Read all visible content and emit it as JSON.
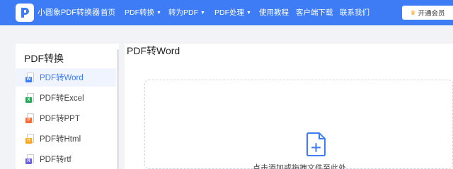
{
  "header": {
    "brand": "小圆象PDF转换器",
    "nav": [
      {
        "label": "首页",
        "dropdown": false
      },
      {
        "label": "PDF转换",
        "dropdown": true
      },
      {
        "label": "转为PDF",
        "dropdown": true
      },
      {
        "label": "PDF处理",
        "dropdown": true
      },
      {
        "label": "使用教程",
        "dropdown": false
      },
      {
        "label": "客户端下载",
        "dropdown": false
      },
      {
        "label": "联系我们",
        "dropdown": false
      }
    ],
    "vip_label": "开通会员"
  },
  "sidebar": {
    "title": "PDF转换",
    "items": [
      {
        "label": "PDF转Word",
        "icon": "word-file-icon",
        "tag": "W",
        "color": "#3d7cf4",
        "active": true
      },
      {
        "label": "PDF转Excel",
        "icon": "excel-file-icon",
        "tag": "X",
        "color": "#2ea35a",
        "active": false
      },
      {
        "label": "PDF转PPT",
        "icon": "ppt-file-icon",
        "tag": "P",
        "color": "#f26b3a",
        "active": false
      },
      {
        "label": "PDF转Html",
        "icon": "html-file-icon",
        "tag": "H",
        "color": "#f5a623",
        "active": false
      },
      {
        "label": "PDF转rtf",
        "icon": "rtf-file-icon",
        "tag": "R",
        "color": "#6c63d9",
        "active": false
      }
    ]
  },
  "main": {
    "title": "PDF转Word",
    "drop_text": "点击添加或拖拽文件至此处"
  },
  "colors": {
    "header_bg": "#3d7cf4",
    "accent": "#3d7cf4",
    "page_bg": "#f2f3f7"
  }
}
